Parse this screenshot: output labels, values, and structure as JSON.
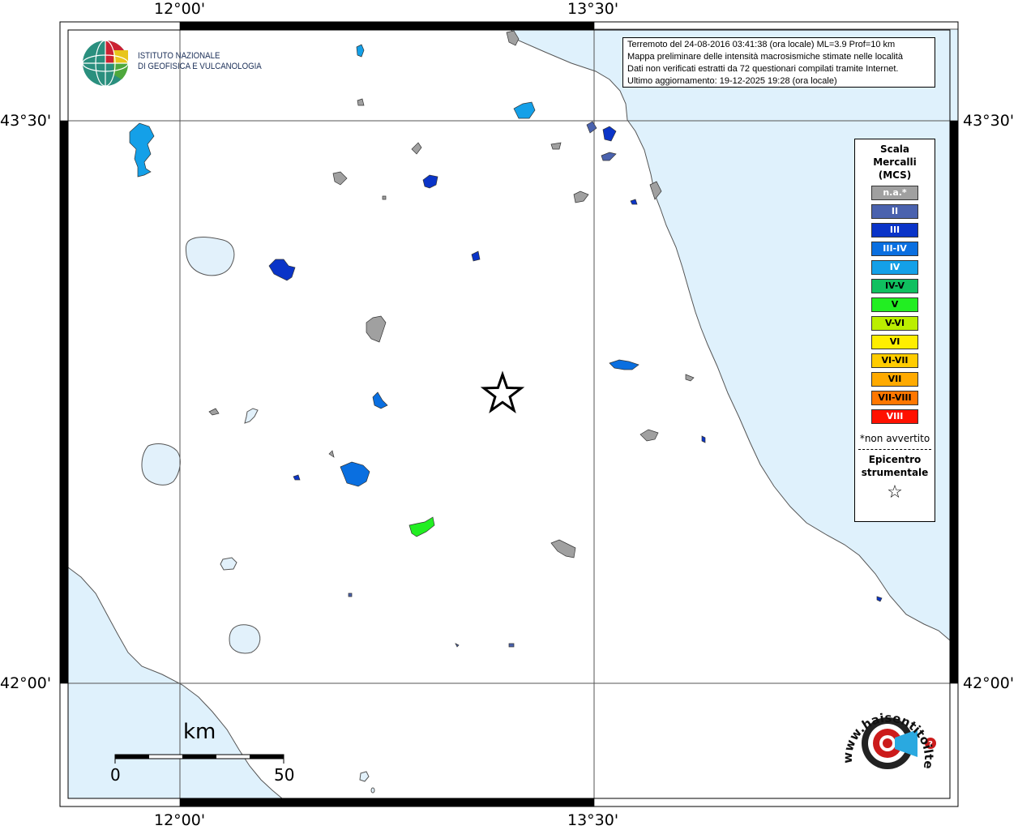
{
  "map": {
    "lon_labels": [
      "12°00'",
      "13°30'"
    ],
    "lat_labels": [
      "43°30'",
      "42°00'"
    ]
  },
  "logo": {
    "institute_line1": "ISTITUTO NAZIONALE",
    "institute_line2": "DI GEOFISICA E VULCANOLOGIA"
  },
  "info": {
    "line1": "Terremoto del 24-08-2016 03:41:38 (ora locale) ML=3.9 Prof=10 km",
    "line2": "Mappa preliminare delle intensità macrosismiche stimate nelle località",
    "line3": "Dati non verificati estratti da 72 questionari compilati tramite Internet.",
    "line4": "Ultimo aggiornamento: 19-12-2025 19:28 (ora locale)"
  },
  "legend": {
    "title1": "Scala",
    "title2": "Mercalli",
    "title3": "(MCS)",
    "classes": [
      {
        "label": "n.a.*",
        "color": "#a0a0a0",
        "text": "#ffffff"
      },
      {
        "label": "II",
        "color": "#4a62ae",
        "text": "#ffffff"
      },
      {
        "label": "III",
        "color": "#0a34c8",
        "text": "#ffffff"
      },
      {
        "label": "III-IV",
        "color": "#0a6fe0",
        "text": "#ffffff"
      },
      {
        "label": "IV",
        "color": "#14a0e8",
        "text": "#ffffff"
      },
      {
        "label": "IV-V",
        "color": "#10c060",
        "text": "#000000"
      },
      {
        "label": "V",
        "color": "#22ee22",
        "text": "#000000"
      },
      {
        "label": "V-VI",
        "color": "#bbee00",
        "text": "#000000"
      },
      {
        "label": "VI",
        "color": "#ffee00",
        "text": "#000000"
      },
      {
        "label": "VI-VII",
        "color": "#ffcc00",
        "text": "#000000"
      },
      {
        "label": "VII",
        "color": "#ffaa00",
        "text": "#000000"
      },
      {
        "label": "VII-VIII",
        "color": "#ff7700",
        "text": "#000000"
      },
      {
        "label": "VIII",
        "color": "#ff1100",
        "text": "#ffffff"
      }
    ],
    "note": "*non avvertito",
    "epicenter1": "Epicentro",
    "epicenter2": "strumentale",
    "star": "☆"
  },
  "scalebar": {
    "unit": "km",
    "start": "0",
    "end": "50"
  },
  "hsit": {
    "url": "www.haisentitoilterremoto.it"
  },
  "colors": {
    "sea": "#dff1fc",
    "lake": "#e2f1fb",
    "coast": "#555555"
  }
}
